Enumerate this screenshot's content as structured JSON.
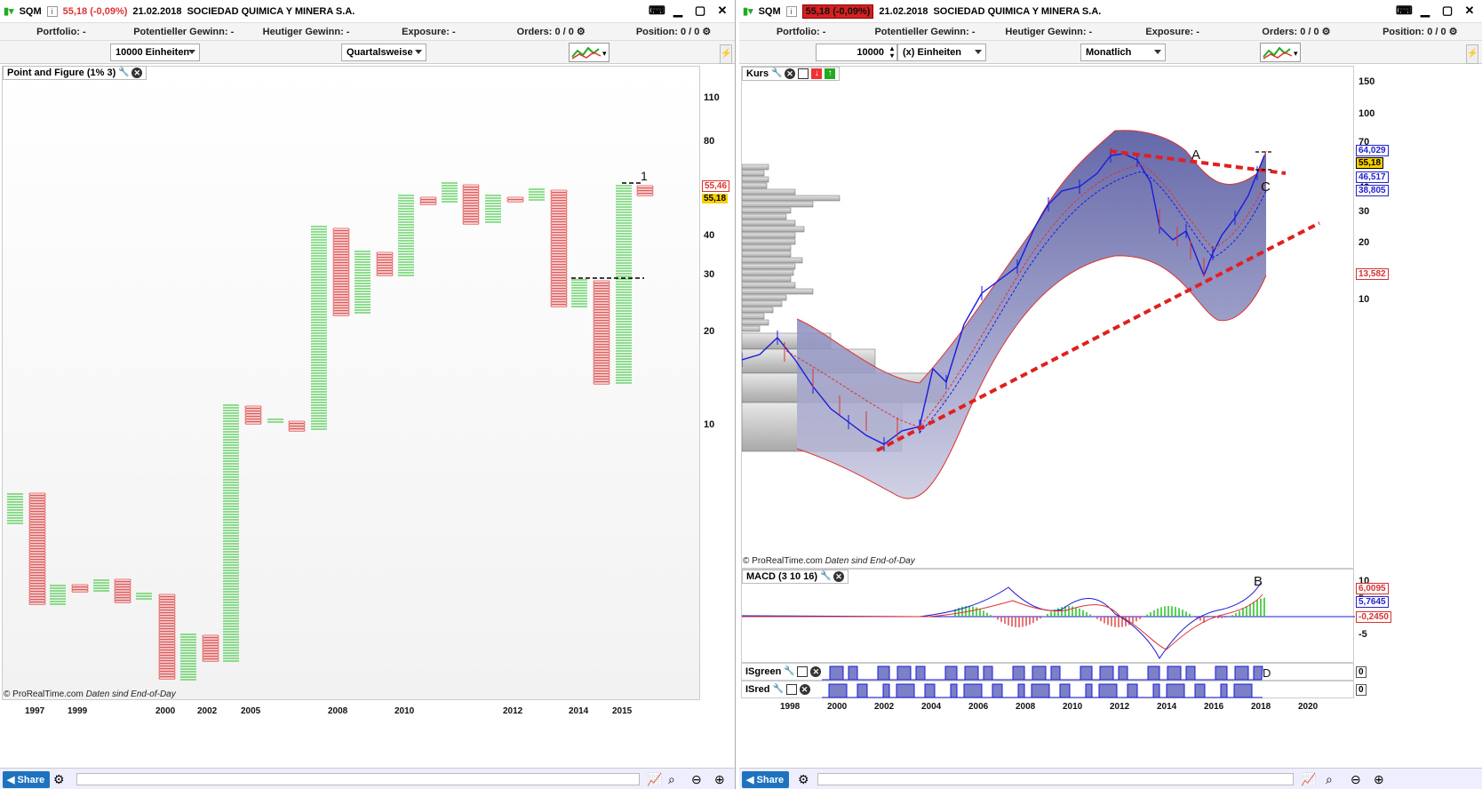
{
  "left": {
    "symbol": "SQM",
    "change": "55,18 (-0,09%)",
    "date": "21.02.2018",
    "company": "SOCIEDAD QUIMICA Y MINERA S.A.",
    "stats": [
      {
        "label": "Portfolio:",
        "value": "-"
      },
      {
        "label": "Potentieller Gewinn:",
        "value": "-"
      },
      {
        "label": "Heutiger Gewinn:",
        "value": "-"
      },
      {
        "label": "Exposure:",
        "value": "-"
      },
      {
        "label": "Orders:",
        "value": "0 / 0"
      },
      {
        "label": "Position:",
        "value": "0 / 0"
      }
    ],
    "units_dropdown": "10000 Einheiten",
    "period_dropdown": "Quartalsweise",
    "panel_title": "Point and Figure (1% 3)",
    "watermark": "© ProRealTime.com",
    "watermark_note": "Daten sind End-of-Day",
    "y_ticks": [
      "110",
      "80",
      "40",
      "30",
      "20",
      "10"
    ],
    "x_ticks": [
      "1997",
      "1999",
      "2000",
      "2002",
      "2005",
      "2008",
      "2010",
      "2012",
      "2014",
      "2015"
    ],
    "price_boxes": [
      {
        "text": "55,46",
        "color": "#d33333"
      },
      {
        "text": "55,18",
        "color": "#000000"
      }
    ],
    "annotation": "1",
    "share_label": "Share"
  },
  "right": {
    "symbol": "SQM",
    "change": "55,18 (-0,09%)",
    "date": "21.02.2018",
    "company": "SOCIEDAD QUIMICA Y MINERA S.A.",
    "stats": [
      {
        "label": "Portfolio:",
        "value": "-"
      },
      {
        "label": "Potentieller Gewinn:",
        "value": "-"
      },
      {
        "label": "Heutiger Gewinn:",
        "value": "-"
      },
      {
        "label": "Exposure:",
        "value": "-"
      },
      {
        "label": "Orders:",
        "value": "0 / 0"
      },
      {
        "label": "Position:",
        "value": "0 / 0"
      }
    ],
    "units_value": "10000",
    "units_dropdown": "(x) Einheiten",
    "period_dropdown": "Monatlich",
    "panel_kurs": "Kurs",
    "panel_macd": "MACD (3 10 16)",
    "panel_isgreen": "ISgreen",
    "panel_isred": "ISred",
    "watermark": "© ProRealTime.com",
    "watermark_note": "Daten sind End-of-Day",
    "y_ticks": [
      "150",
      "100",
      "70",
      "50",
      "40",
      "30",
      "20",
      "10"
    ],
    "price_boxes": [
      {
        "text": "64,029",
        "color": "#2222cc"
      },
      {
        "text": "55,18",
        "color": "#000000"
      },
      {
        "text": "46,517",
        "color": "#2222cc"
      },
      {
        "text": "38,805",
        "color": "#2222cc"
      },
      {
        "text": "13,582",
        "color": "#d33333"
      }
    ],
    "macd_ticks": [
      "10",
      "5",
      "-5"
    ],
    "macd_boxes": [
      {
        "text": "6,0095",
        "color": "#d33333"
      },
      {
        "text": "5,7645",
        "color": "#2222cc"
      },
      {
        "text": "-0,2450",
        "color": "#d33333"
      }
    ],
    "isgreen_value": "0",
    "isred_value": "0",
    "x_ticks": [
      "1998",
      "2000",
      "2002",
      "2004",
      "2006",
      "2008",
      "2010",
      "2012",
      "2014",
      "2016",
      "2018",
      "2020"
    ],
    "labels": {
      "a": "A",
      "b": "B",
      "c": "C",
      "d": "D"
    },
    "share_label": "Share"
  }
}
